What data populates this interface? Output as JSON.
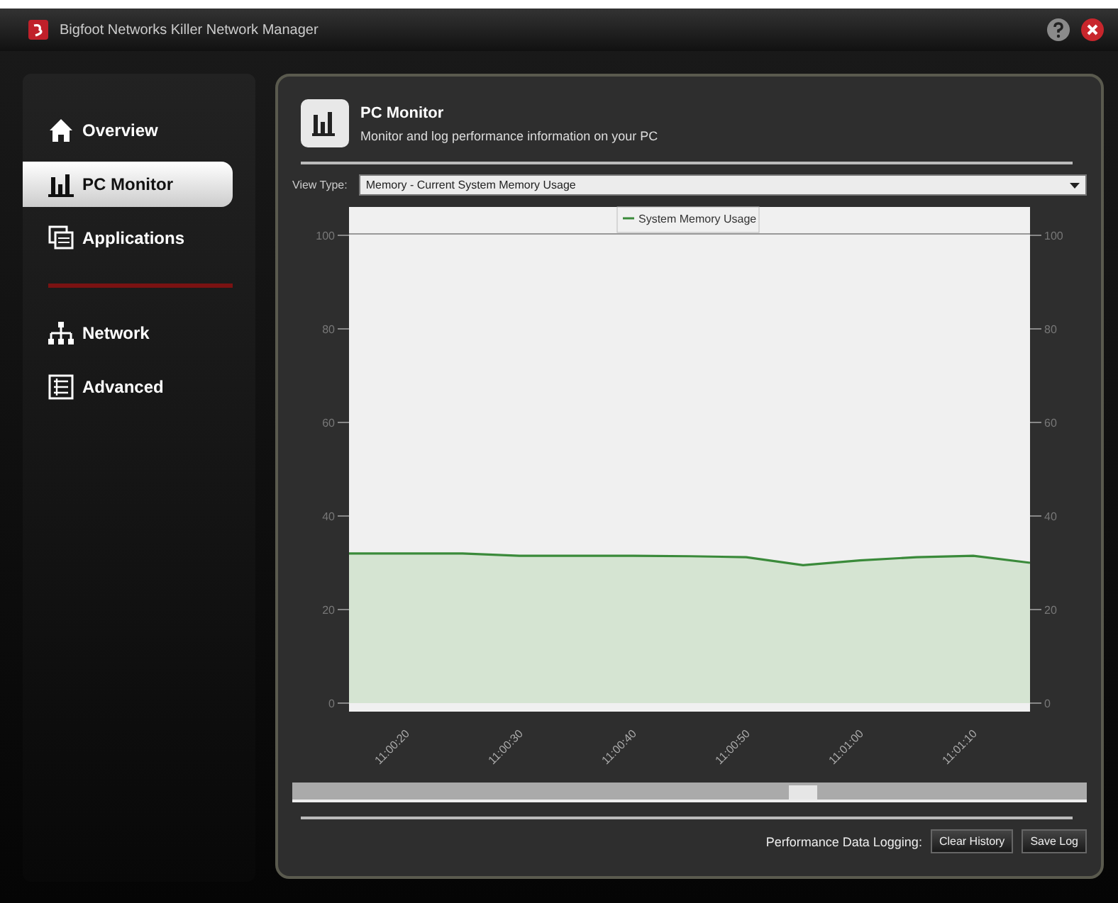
{
  "window": {
    "title": "Bigfoot Networks Killer Network Manager"
  },
  "sidebar": {
    "items": [
      {
        "label": "Overview",
        "selected": false
      },
      {
        "label": "PC Monitor",
        "selected": true
      },
      {
        "label": "Applications",
        "selected": false
      },
      {
        "label": "Network",
        "selected": false
      },
      {
        "label": "Advanced",
        "selected": false
      }
    ]
  },
  "header": {
    "title": "PC Monitor",
    "subtitle": "Monitor and log performance information on your PC"
  },
  "view_type": {
    "label": "View Type:",
    "value": "Memory - Current System Memory Usage"
  },
  "chart": {
    "chart_data": {
      "type": "area",
      "categories": [
        null,
        "11:00:20",
        null,
        "11:00:30",
        null,
        "11:00:40",
        null,
        "11:00:50",
        null,
        "11:01:00",
        null,
        "11:01:10",
        null
      ],
      "series": [
        {
          "name": "System Memory Usage",
          "color": "#3a8a3a",
          "values": [
            32,
            32,
            32,
            31.5,
            31.5,
            31.5,
            31.4,
            31.2,
            29.5,
            30.5,
            31.2,
            31.5,
            30
          ]
        }
      ],
      "ylim": [
        0,
        100
      ],
      "yticks": [
        0,
        20,
        40,
        60,
        80,
        100
      ]
    },
    "right_axis_labels": [
      "100",
      "80",
      "60",
      "40",
      "20",
      "0"
    ]
  },
  "footer": {
    "label": "Performance Data Logging:",
    "buttons": [
      "Clear History",
      "Save Log"
    ]
  }
}
